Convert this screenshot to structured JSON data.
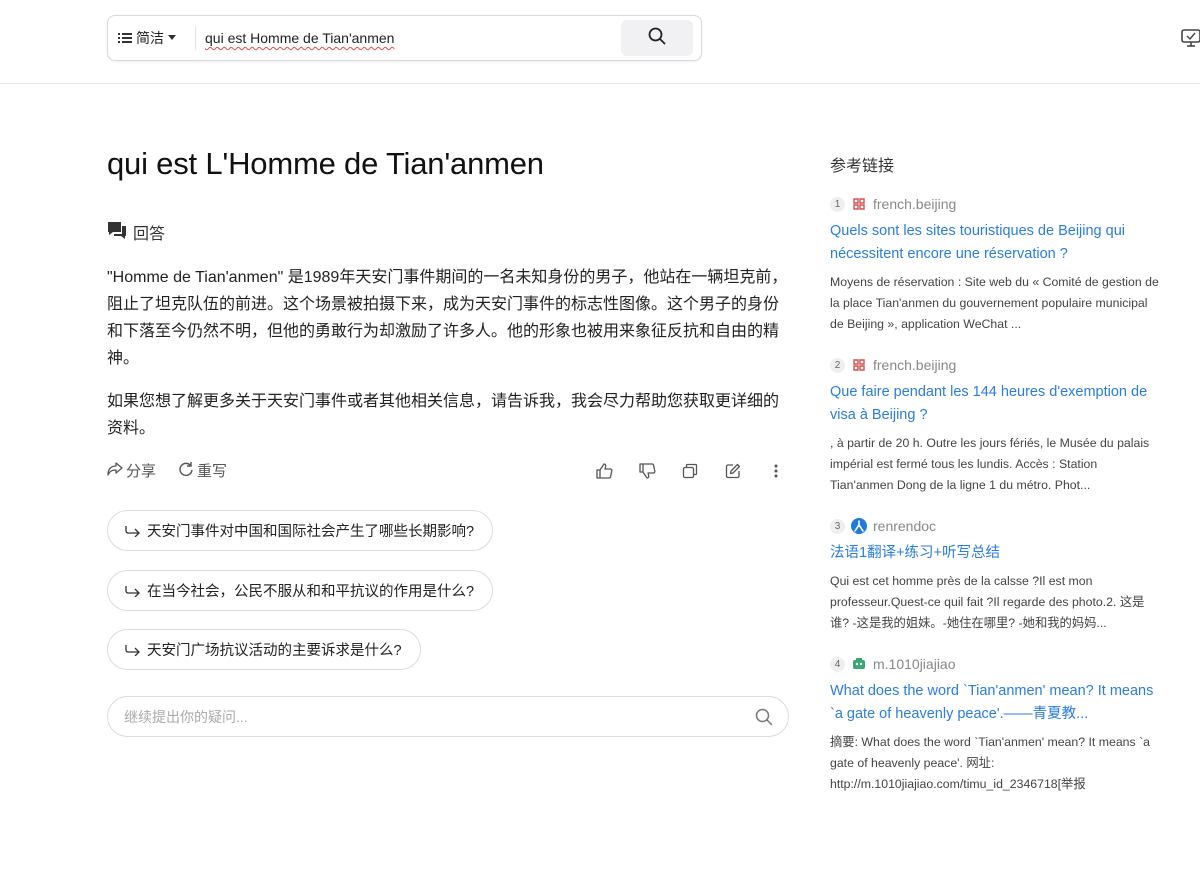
{
  "header": {
    "mode_label": "简洁",
    "query": "qui est Homme de Tian'anmen",
    "icons": [
      "menu-icon",
      "chevron-down-icon",
      "search-icon",
      "monitor-icon"
    ]
  },
  "main": {
    "title": "qui est L'Homme de Tian'anmen",
    "answer_label": "回答",
    "paragraph1": "\"Homme de Tian'anmen\" 是1989年天安门事件期间的一名未知身份的男子，他站在一辆坦克前，阻止了坦克队伍的前进。这个场景被拍摄下来，成为天安门事件的标志性图像。这个男子的身份和下落至今仍然不明，但他的勇敢行为却激励了许多人。他的形象也被用来象征反抗和自由的精神。",
    "paragraph2": "如果您想了解更多关于天安门事件或者其他相关信息，请告诉我，我会尽力帮助您获取更详细的资料。",
    "share_label": "分享",
    "rewrite_label": "重写",
    "action_icons": [
      "thumbs-up-icon",
      "thumbs-down-icon",
      "copy-icon",
      "edit-icon",
      "more-icon"
    ],
    "suggestions": [
      "天安门事件对中国和国际社会产生了哪些长期影响?",
      "在当今社会，公民不服从和和平抗议的作用是什么?",
      "天安门广场抗议活动的主要诉求是什么?"
    ],
    "followup_placeholder": "继续提出你的疑问..."
  },
  "references": {
    "title": "参考链接",
    "items": [
      {
        "num": "1",
        "source": "french.beijing",
        "title": "Quels sont les sites touristiques de Beijing qui nécessitent encore une réservation ?",
        "snippet": "Moyens de réservation : Site web du « Comité de gestion de la place Tian'anmen du gouvernement populaire municipal de Beijing », application WeChat ..."
      },
      {
        "num": "2",
        "source": "french.beijing",
        "title": "Que faire pendant les 144 heures d'exemption de visa à Beijing ?",
        "snippet": ", à partir de 20 h. Outre les jours fériés, le Musée du palais impérial est fermé tous les lundis. Accès : Station Tian'anmen Dong de la ligne 1 du métro. Phot..."
      },
      {
        "num": "3",
        "source": "renrendoc",
        "title": "法语1翻译+练习+听写总结",
        "snippet": "Qui est cet homme près de la calsse ?Il est mon professeur.Quest-ce quil fait ?Il regarde des photo.2. 这是谁? -这是我的姐妹。-她住在哪里? -她和我的妈妈..."
      },
      {
        "num": "4",
        "source": "m.1010jiajiao",
        "title": "What does the word `Tian'anmen' mean? It means `a gate of heavenly peace'.——青夏教...",
        "snippet": "摘要: What does the word `Tian'anmen' mean? It means `a gate of heavenly peace'. 网址: http://m.1010jiajiao.com/timu_id_2346718[举报"
      }
    ]
  },
  "colors": {
    "link": "#2a7de1",
    "border": "#dcdcdc"
  }
}
